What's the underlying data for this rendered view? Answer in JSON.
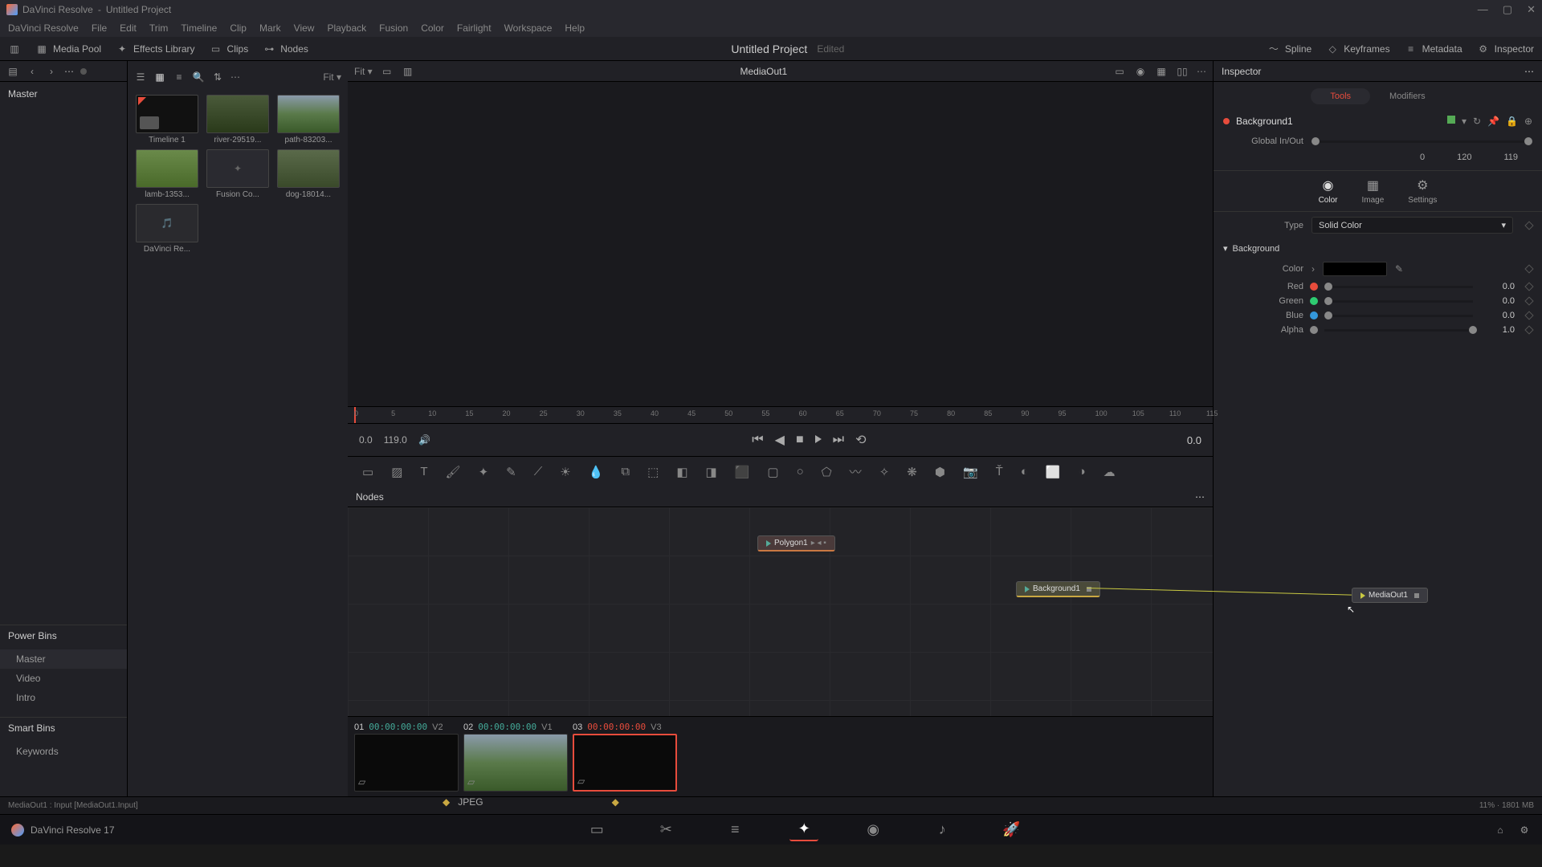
{
  "titlebar": {
    "app": "DaVinci Resolve",
    "project": "Untitled Project"
  },
  "menu": [
    "DaVinci Resolve",
    "File",
    "Edit",
    "Trim",
    "Timeline",
    "Clip",
    "Mark",
    "View",
    "Playback",
    "Fusion",
    "Color",
    "Fairlight",
    "Workspace",
    "Help"
  ],
  "toolbar": {
    "media_pool": "Media Pool",
    "effects": "Effects Library",
    "clips": "Clips",
    "nodes": "Nodes",
    "title": "Untitled Project",
    "edited": "Edited",
    "spline": "Spline",
    "keyframes": "Keyframes",
    "metadata": "Metadata",
    "inspector": "Inspector"
  },
  "bins": {
    "master": "Master",
    "power": "Power Bins",
    "items": [
      "Master",
      "Video",
      "Intro"
    ],
    "smart": "Smart Bins",
    "smart_items": [
      "Keywords"
    ]
  },
  "media": {
    "fit": "Fit ▾",
    "items": [
      {
        "name": "Timeline 1",
        "type": "timeline"
      },
      {
        "name": "river-29519...",
        "type": "nature1"
      },
      {
        "name": "path-83203...",
        "type": "nature2"
      },
      {
        "name": "lamb-1353...",
        "type": "nature3"
      },
      {
        "name": "Fusion Co...",
        "type": "gray"
      },
      {
        "name": "dog-18014...",
        "type": "nature4"
      },
      {
        "name": "DaVinci Re...",
        "type": "audio"
      }
    ]
  },
  "viewer": {
    "title": "MediaOut1",
    "time_start": "0.0",
    "time_end": "119.0",
    "readout": "0.0",
    "ticks": [
      "0",
      "5",
      "10",
      "15",
      "20",
      "25",
      "30",
      "35",
      "40",
      "45",
      "50",
      "55",
      "60",
      "65",
      "70",
      "75",
      "80",
      "85",
      "90",
      "95",
      "100",
      "105",
      "110",
      "115"
    ]
  },
  "nodes_panel": {
    "title": "Nodes",
    "nodes": {
      "poly": "Polygon1",
      "bg": "Background1",
      "out": "MediaOut1"
    }
  },
  "clips": [
    {
      "num": "01",
      "tc": "00:00:00:00",
      "trk": "V2",
      "sel": false,
      "img": "black"
    },
    {
      "num": "02",
      "tc": "00:00:00:00",
      "trk": "V1",
      "sel": false,
      "img": "nature2"
    },
    {
      "num": "03",
      "tc": "00:00:00:00",
      "trk": "V3",
      "sel": true,
      "img": "black",
      "tc_red": true
    }
  ],
  "clip_meta": "JPEG",
  "inspector": {
    "title": "Inspector",
    "tabs": {
      "tools": "Tools",
      "modifiers": "Modifiers"
    },
    "node": "Background1",
    "global": "Global In/Out",
    "in": "0",
    "mid": "120",
    "out": "119",
    "modes": {
      "color": "Color",
      "image": "Image",
      "settings": "Settings"
    },
    "type_label": "Type",
    "type_value": "Solid Color",
    "section": "Background",
    "color_label": "Color",
    "channels": [
      {
        "name": "Red",
        "color": "#e74c3c",
        "val": "0.0"
      },
      {
        "name": "Green",
        "color": "#2ecc71",
        "val": "0.0"
      },
      {
        "name": "Blue",
        "color": "#3498db",
        "val": "0.0"
      },
      {
        "name": "Alpha",
        "color": "#888",
        "val": "1.0"
      }
    ]
  },
  "status": {
    "left": "MediaOut1 : Input   [MediaOut1.Input]",
    "right": "11% · 1801 MB"
  },
  "bottom": {
    "app": "DaVinci Resolve 17"
  }
}
